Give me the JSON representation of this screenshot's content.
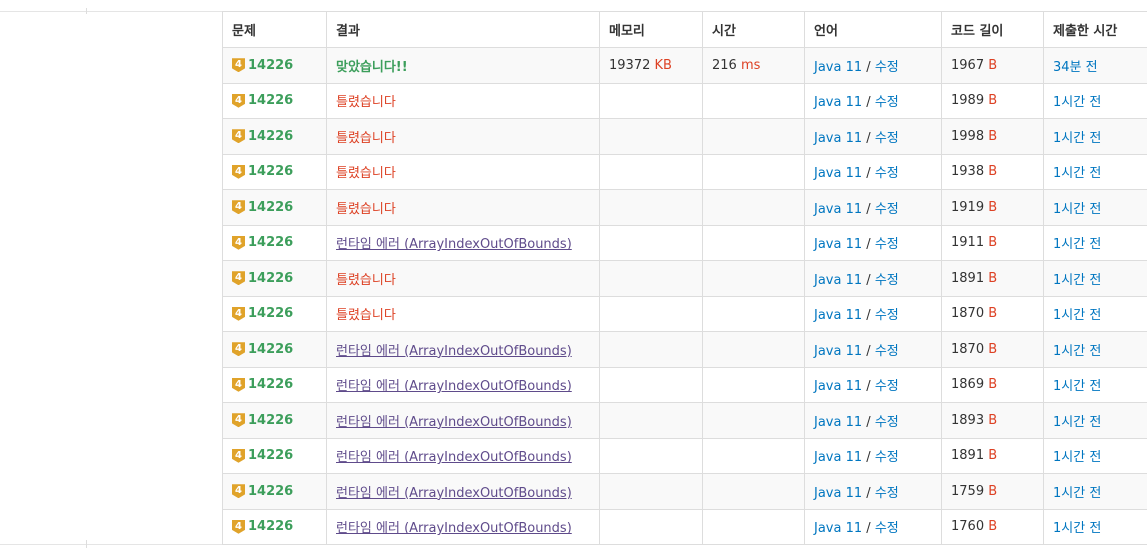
{
  "table": {
    "headers": [
      "문제",
      "결과",
      "메모리",
      "시간",
      "언어",
      "코드 길이",
      "제출한 시간"
    ],
    "rows": [
      {
        "tier": "4",
        "problem": "14226",
        "result": "맞았습니다!!",
        "result_type": "ac",
        "memory": "19372",
        "memory_unit": "KB",
        "time": "216",
        "time_unit": "ms",
        "language": "Java 11",
        "slash": "/",
        "edit": "수정",
        "length": "1967",
        "length_unit": "B",
        "submitted": "34분 전"
      },
      {
        "tier": "4",
        "problem": "14226",
        "result": "틀렸습니다",
        "result_type": "wa",
        "memory": "",
        "memory_unit": "",
        "time": "",
        "time_unit": "",
        "language": "Java 11",
        "slash": "/",
        "edit": "수정",
        "length": "1989",
        "length_unit": "B",
        "submitted": "1시간 전"
      },
      {
        "tier": "4",
        "problem": "14226",
        "result": "틀렸습니다",
        "result_type": "wa",
        "memory": "",
        "memory_unit": "",
        "time": "",
        "time_unit": "",
        "language": "Java 11",
        "slash": "/",
        "edit": "수정",
        "length": "1998",
        "length_unit": "B",
        "submitted": "1시간 전"
      },
      {
        "tier": "4",
        "problem": "14226",
        "result": "틀렸습니다",
        "result_type": "wa",
        "memory": "",
        "memory_unit": "",
        "time": "",
        "time_unit": "",
        "language": "Java 11",
        "slash": "/",
        "edit": "수정",
        "length": "1938",
        "length_unit": "B",
        "submitted": "1시간 전"
      },
      {
        "tier": "4",
        "problem": "14226",
        "result": "틀렸습니다",
        "result_type": "wa",
        "memory": "",
        "memory_unit": "",
        "time": "",
        "time_unit": "",
        "language": "Java 11",
        "slash": "/",
        "edit": "수정",
        "length": "1919",
        "length_unit": "B",
        "submitted": "1시간 전"
      },
      {
        "tier": "4",
        "problem": "14226",
        "result": "런타임 에러 (ArrayIndexOutOfBounds)",
        "result_type": "re",
        "memory": "",
        "memory_unit": "",
        "time": "",
        "time_unit": "",
        "language": "Java 11",
        "slash": "/",
        "edit": "수정",
        "length": "1911",
        "length_unit": "B",
        "submitted": "1시간 전"
      },
      {
        "tier": "4",
        "problem": "14226",
        "result": "틀렸습니다",
        "result_type": "wa",
        "memory": "",
        "memory_unit": "",
        "time": "",
        "time_unit": "",
        "language": "Java 11",
        "slash": "/",
        "edit": "수정",
        "length": "1891",
        "length_unit": "B",
        "submitted": "1시간 전"
      },
      {
        "tier": "4",
        "problem": "14226",
        "result": "틀렸습니다",
        "result_type": "wa",
        "memory": "",
        "memory_unit": "",
        "time": "",
        "time_unit": "",
        "language": "Java 11",
        "slash": "/",
        "edit": "수정",
        "length": "1870",
        "length_unit": "B",
        "submitted": "1시간 전"
      },
      {
        "tier": "4",
        "problem": "14226",
        "result": "런타임 에러 (ArrayIndexOutOfBounds)",
        "result_type": "re",
        "memory": "",
        "memory_unit": "",
        "time": "",
        "time_unit": "",
        "language": "Java 11",
        "slash": "/",
        "edit": "수정",
        "length": "1870",
        "length_unit": "B",
        "submitted": "1시간 전"
      },
      {
        "tier": "4",
        "problem": "14226",
        "result": "런타임 에러 (ArrayIndexOutOfBounds)",
        "result_type": "re",
        "memory": "",
        "memory_unit": "",
        "time": "",
        "time_unit": "",
        "language": "Java 11",
        "slash": "/",
        "edit": "수정",
        "length": "1869",
        "length_unit": "B",
        "submitted": "1시간 전"
      },
      {
        "tier": "4",
        "problem": "14226",
        "result": "런타임 에러 (ArrayIndexOutOfBounds)",
        "result_type": "re",
        "memory": "",
        "memory_unit": "",
        "time": "",
        "time_unit": "",
        "language": "Java 11",
        "slash": "/",
        "edit": "수정",
        "length": "1893",
        "length_unit": "B",
        "submitted": "1시간 전"
      },
      {
        "tier": "4",
        "problem": "14226",
        "result": "런타임 에러 (ArrayIndexOutOfBounds)",
        "result_type": "re",
        "memory": "",
        "memory_unit": "",
        "time": "",
        "time_unit": "",
        "language": "Java 11",
        "slash": "/",
        "edit": "수정",
        "length": "1891",
        "length_unit": "B",
        "submitted": "1시간 전"
      },
      {
        "tier": "4",
        "problem": "14226",
        "result": "런타임 에러 (ArrayIndexOutOfBounds)",
        "result_type": "re",
        "memory": "",
        "memory_unit": "",
        "time": "",
        "time_unit": "",
        "language": "Java 11",
        "slash": "/",
        "edit": "수정",
        "length": "1759",
        "length_unit": "B",
        "submitted": "1시간 전"
      },
      {
        "tier": "4",
        "problem": "14226",
        "result": "런타임 에러 (ArrayIndexOutOfBounds)",
        "result_type": "re",
        "memory": "",
        "memory_unit": "",
        "time": "",
        "time_unit": "",
        "language": "Java 11",
        "slash": "/",
        "edit": "수정",
        "length": "1760",
        "length_unit": "B",
        "submitted": "1시간 전"
      }
    ]
  },
  "colors": {
    "accepted": "#3c9e5b",
    "wrong": "#dd4124",
    "runtime_error": "#5f4b8b",
    "link": "#0076c0",
    "tier_badge": "#e0a32a"
  },
  "icons": {
    "tier_badge": "gold-tier-4-icon"
  }
}
